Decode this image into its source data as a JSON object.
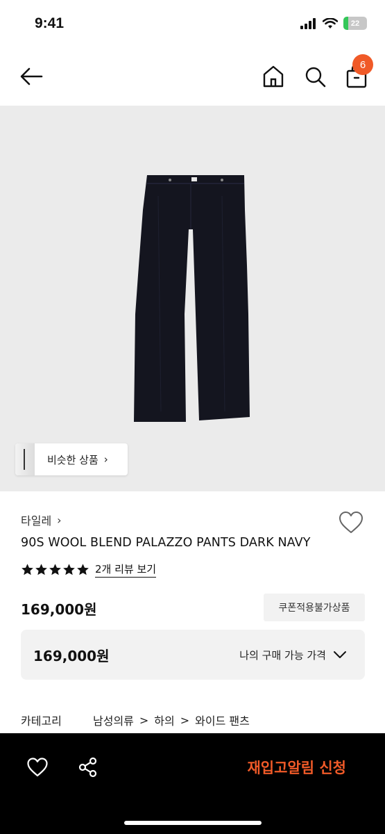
{
  "status_bar": {
    "time": "9:41",
    "battery": "22",
    "battery_level": 0.22
  },
  "nav": {
    "cart_count": "6"
  },
  "hero": {
    "similar_products_label": "비슷한 상품",
    "similar_chevron": "›"
  },
  "product": {
    "brand": "타일레",
    "brand_chevron": "›",
    "title": "90S WOOL BLEND PALAZZO PANTS DARK NAVY",
    "rating_stars": 5,
    "review_link": "2개 리뷰 보기",
    "price": "169,000원",
    "coupon_badge": "쿠폰적용불가상품"
  },
  "my_price": {
    "value": "169,000원",
    "label": "나의 구매 가능 가격"
  },
  "category": {
    "label": "카테고리",
    "path": [
      "남성의류",
      "하의",
      "와이드 팬츠"
    ],
    "separator": ">"
  },
  "bottom_bar": {
    "restock_button": "재입고알림 신청"
  },
  "colors": {
    "accent": "#f05a28",
    "pants": "#14151f",
    "hero_bg": "#ebebeb"
  },
  "icons": [
    "back-arrow-icon",
    "home-icon",
    "search-icon",
    "shopping-bag-icon",
    "heart-icon",
    "star-icon",
    "chevron-down-icon",
    "share-icon"
  ]
}
